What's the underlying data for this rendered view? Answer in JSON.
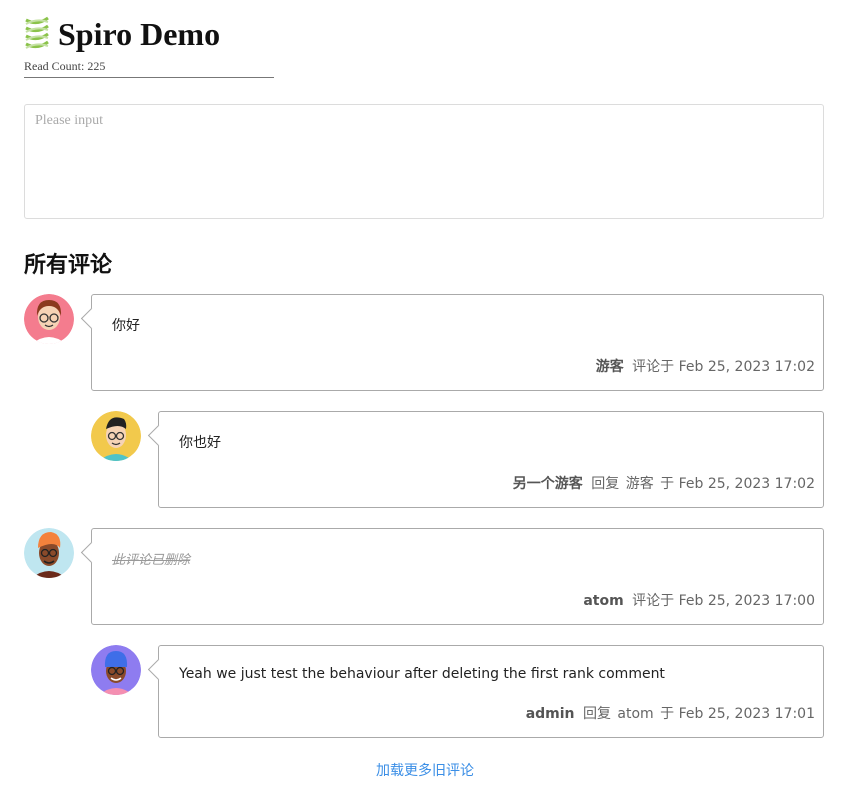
{
  "site": {
    "title": "Spiro Demo",
    "read_count_label": "Read Count:",
    "read_count": "225",
    "logo_icon": "helix-icon",
    "logo_color": "#8bc34a"
  },
  "editor": {
    "placeholder": "Please input"
  },
  "comments_section": {
    "title": "所有评论"
  },
  "comments": [
    {
      "avatar": "avatar-woman-glasses",
      "avatar_bg": "#f47c8e",
      "content": "你好",
      "author": "游客",
      "action": "评论于",
      "reply_to": "",
      "on": "",
      "date": "Feb 25, 2023 17:02"
    },
    {
      "avatar": "avatar-man-glasses",
      "avatar_bg": "#f2c94c",
      "content": "你也好",
      "author": "另一个游客",
      "action": "回复",
      "reply_to": "游客",
      "on": "于",
      "date": "Feb 25, 2023 17:02"
    },
    {
      "avatar": "avatar-man-orange-hair",
      "avatar_bg": "#bfe6f0",
      "content": "此评论已删除",
      "author": "atom",
      "action": "评论于",
      "reply_to": "",
      "on": "",
      "date": "Feb 25, 2023 17:00"
    },
    {
      "avatar": "avatar-man-blue-beanie",
      "avatar_bg": "#8e7cf0",
      "content": "Yeah we just test the behaviour after deleting the first rank comment",
      "author": "admin",
      "action": "回复",
      "reply_to": "atom",
      "on": "于",
      "date": "Feb 25, 2023 17:01"
    }
  ],
  "load_more": "加载更多旧评论"
}
